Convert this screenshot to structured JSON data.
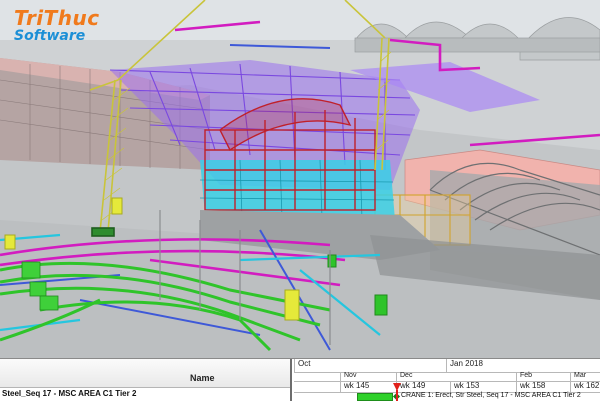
{
  "brand": {
    "line1": "TriThuc",
    "line2": "Software",
    "colors": {
      "line1": "#f07a1c",
      "line2": "#1c8fd6"
    }
  },
  "scene": {
    "description_icon": "bim-3d-model-icon",
    "palette": {
      "sky": "#dfe3e6",
      "ground": "#c9ccce",
      "steel_purple": "#8a5be8",
      "steel_red": "#c0202a",
      "steel_cyan": "#27c7e0",
      "pipe_green": "#2fc42a",
      "pipe_magenta": "#d21cc0",
      "crane_yellow": "#d8d238",
      "equipment_yellow": "#e5e93a",
      "concrete": "#a9abad",
      "salmon": "#f4a3a0"
    }
  },
  "schedule": {
    "name_header": "Name",
    "name_row": "Steel_Seq 17 - MSC AREA C1 Tier 2",
    "months": [
      "Oct",
      "Jan 2018"
    ],
    "submonths": [
      "Nov",
      "Dec",
      "Feb",
      "Mar"
    ],
    "weeks": [
      "wk 145",
      "wk 149",
      "wk 153",
      "wk 158",
      "wk 162"
    ],
    "task_label": "CRANE 1: Erect, Str Steel, Seq 17 - MSC AREA C1 Tier 2",
    "bar_color": "#2fd12a",
    "today_color": "#e0201a"
  }
}
